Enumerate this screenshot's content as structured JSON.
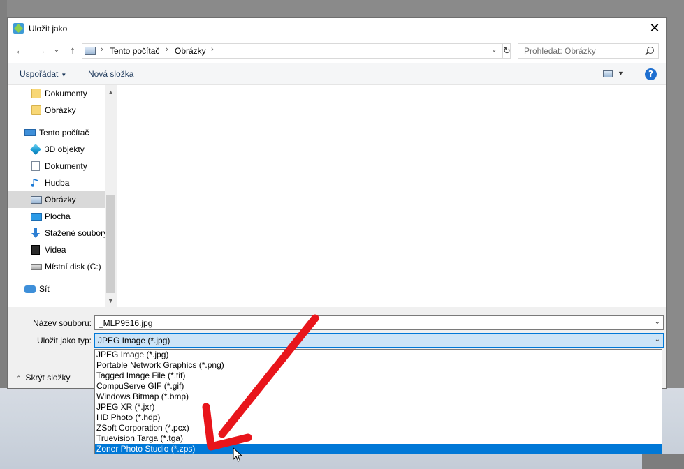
{
  "window": {
    "title": "Uložit jako",
    "close_glyph": "✕"
  },
  "nav": {
    "back_glyph": "←",
    "forward_glyph": "→",
    "recent_glyph": "⌄",
    "up_glyph": "↑",
    "breadcrumbs": [
      "Tento počítač",
      "Obrázky"
    ],
    "crumb_sep": "›",
    "refresh_glyph": "↻",
    "dropdown_glyph": "⌄",
    "search_placeholder": "Prohledat: Obrázky"
  },
  "toolbar": {
    "organize_label": "Uspořádat",
    "organize_arrow": "▼",
    "new_folder_label": "Nová složka",
    "view_dropdown": "▼",
    "help_glyph": "?"
  },
  "sidebar": {
    "scroll_up": "▲",
    "scroll_down": "▼",
    "items": [
      {
        "label": "Dokumenty",
        "icon": "folder-icon"
      },
      {
        "label": "Obrázky",
        "icon": "folder-icon"
      },
      {
        "label": "Tento počítač",
        "icon": "computer-icon"
      },
      {
        "label": "3D objekty",
        "icon": "cube-icon"
      },
      {
        "label": "Dokumenty",
        "icon": "document-icon"
      },
      {
        "label": "Hudba",
        "icon": "music-note-icon"
      },
      {
        "label": "Obrázky",
        "icon": "pictures-icon",
        "selected": true
      },
      {
        "label": "Plocha",
        "icon": "desktop-icon"
      },
      {
        "label": "Stažené soubory",
        "icon": "download-icon"
      },
      {
        "label": "Videa",
        "icon": "video-icon"
      },
      {
        "label": "Místní disk (C:)",
        "icon": "disk-icon"
      },
      {
        "label": "Síť",
        "icon": "network-icon"
      }
    ]
  },
  "form": {
    "filename_label": "Název souboru:",
    "filename_value": "_MLP9516.jpg",
    "type_label": "Uložit jako typ:",
    "type_value": "JPEG Image (*.jpg)",
    "dropdown_glyph": "⌄",
    "hide_folders_label": "Skrýt složky",
    "hide_folders_glyph": "⌃"
  },
  "type_options": [
    "JPEG Image (*.jpg)",
    "Portable Network Graphics (*.png)",
    "Tagged Image File (*.tif)",
    "CompuServe GIF (*.gif)",
    "Windows Bitmap (*.bmp)",
    "JPEG XR (*.jxr)",
    "HD Photo (*.hdp)",
    "ZSoft Corporation (*.pcx)",
    "Truevision Targa (*.tga)",
    "Zoner Photo Studio (*.zps)"
  ],
  "highlighted_option": "Zoner Photo Studio (*.zps)",
  "colors": {
    "accent": "#0078d7",
    "annotation_arrow": "#e8151b",
    "link_text": "#1e395b"
  }
}
